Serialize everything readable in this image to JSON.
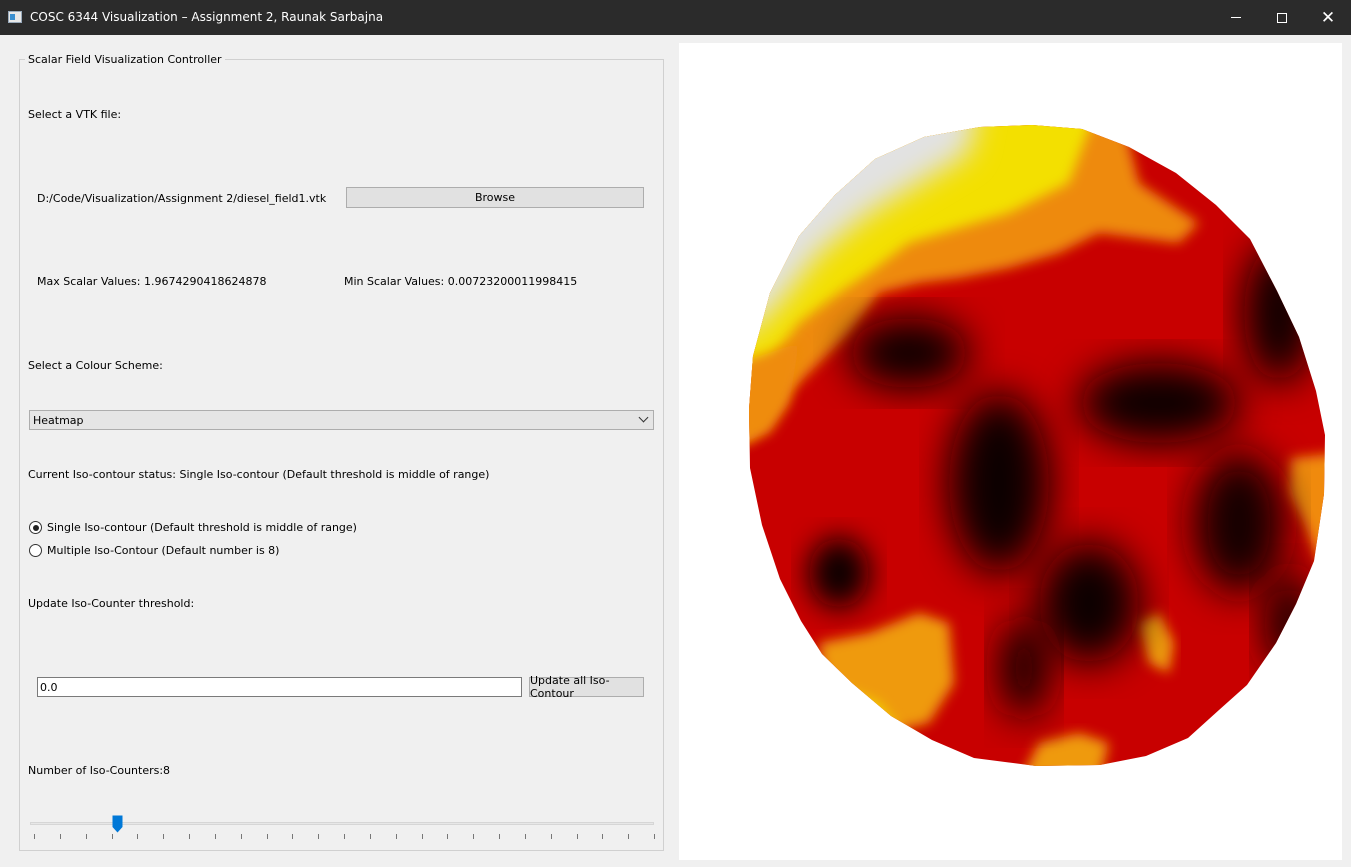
{
  "window": {
    "title": "COSC 6344 Visualization – Assignment 2, Raunak Sarbajna",
    "minimize_glyph": "",
    "maximize_glyph": "",
    "close_glyph": "✕"
  },
  "controller": {
    "group_title": "Scalar Field Visualization Controller",
    "file_prompt": "Select a VTK file:",
    "file_path": "D:/Code/Visualization/Assignment 2/diesel_field1.vtk",
    "browse_label": "Browse",
    "max_scalar": "Max Scalar Values: 1.9674290418624878",
    "min_scalar": "Min Scalar Values: 0.00723200011998415",
    "colour_prompt": "Select a Colour Scheme:",
    "colour_scheme": "Heatmap",
    "iso_status": "Current Iso-contour status: Single Iso-contour (Default threshold is middle of range)",
    "radio_single": "Single Iso-contour (Default threshold is middle of range)",
    "radio_multiple": "Multiple Iso-Contour (Default number is 8)",
    "threshold_prompt": "Update Iso-Counter threshold:",
    "threshold_value": "0.0",
    "update_button": "Update all Iso-Contour",
    "count_label": "Number of Iso-Counters:8",
    "slider_value": 8,
    "slider_fraction": 0.14,
    "slider_tick_count": 25
  },
  "colors": {
    "titlebar": "#2b2b2b",
    "slider_handle": "#0078d7",
    "heatmap_white": "#e2e2e2",
    "heatmap_yellow": "#f3e000",
    "heatmap_orange": "#ef9a10",
    "heatmap_red": "#c80000",
    "heatmap_black": "#0d0000"
  }
}
